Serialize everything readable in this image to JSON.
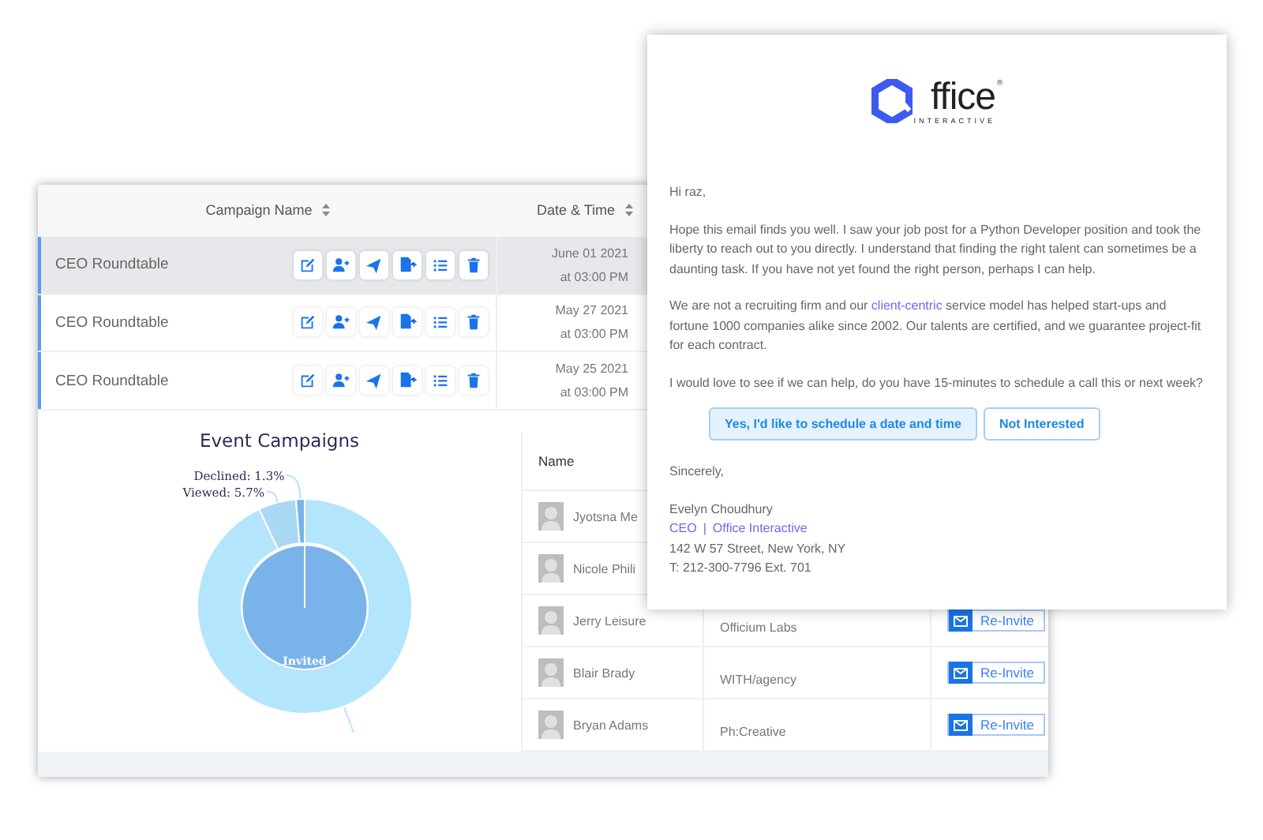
{
  "campaign_table": {
    "columns": [
      {
        "label": "Campaign Name"
      },
      {
        "label": "Date & Time"
      }
    ],
    "rows": [
      {
        "name": "CEO Roundtable",
        "selected": true,
        "date": "June 01 2021",
        "time": "at 03:00 PM"
      },
      {
        "name": "CEO Roundtable",
        "selected": false,
        "date": "May 27 2021",
        "time": "at 03:00 PM"
      },
      {
        "name": "CEO Roundtable",
        "selected": false,
        "date": "May 25 2021",
        "time": "at 03:00 PM"
      }
    ]
  },
  "chart": {
    "chart_data": {
      "type": "donut",
      "title": "Event Campaigns",
      "values": [
        5.7,
        1.3,
        93.0
      ],
      "value_labels": [
        "Viewed: 5.7%",
        "Declined: 1.3%",
        null
      ],
      "annotations": [
        {
          "text": "Invited"
        }
      ]
    }
  },
  "invite_table": {
    "columns": [
      {
        "label": "Name"
      }
    ],
    "rows": [
      {
        "name": "Jyotsna Me"
      },
      {
        "name": "Nicole Phili"
      },
      {
        "name": "Jerry Leisure",
        "company": "Officium Labs",
        "action": "Re-Invite"
      },
      {
        "name": "Blair Brady",
        "company": "WITH/agency",
        "action": "Re-Invite"
      },
      {
        "name": "Bryan Adams",
        "company": "Ph:Creative",
        "action": "Re-Invite"
      }
    ]
  },
  "email": {
    "logo": {
      "wordmark": "ffice",
      "mark": "®",
      "tagline": "INTERACTIVE"
    },
    "greeting": "Hi raz,",
    "paragraphs": [
      [
        {
          "kind": "text",
          "text": "Hope this email finds you well. I saw your job post for a Python Developer position and took the liberty to reach out to you directly. I understand that finding the right talent can sometimes be a daunting task. If you have not yet found the right person, perhaps I can help."
        }
      ],
      [
        {
          "kind": "text",
          "text": "We are not a recruiting firm and our "
        },
        {
          "kind": "link",
          "text": "client-centric"
        },
        {
          "kind": "text",
          "text": " service model has helped start-ups and fortune 1000 companies alike since 2002. Our talents are certified, and we guarantee project-fit for each contract."
        }
      ],
      [
        {
          "kind": "text",
          "text": "I would love to see if we can help, do you have 15-minutes to schedule a call this or next week?"
        }
      ]
    ],
    "buttons": [
      {
        "label": "Yes, I'd like to schedule a date and time",
        "primary": true
      },
      {
        "label": "Not Interested",
        "primary": false
      }
    ],
    "closing": "Sincerely,",
    "signature": {
      "name": "Evelyn Choudhury",
      "title": "CEO",
      "separator": "|",
      "company": "Office Interactive",
      "address": "142 W 57 Street, New York, NY",
      "phone": "T: 212-300-7796 Ext. 701"
    }
  }
}
